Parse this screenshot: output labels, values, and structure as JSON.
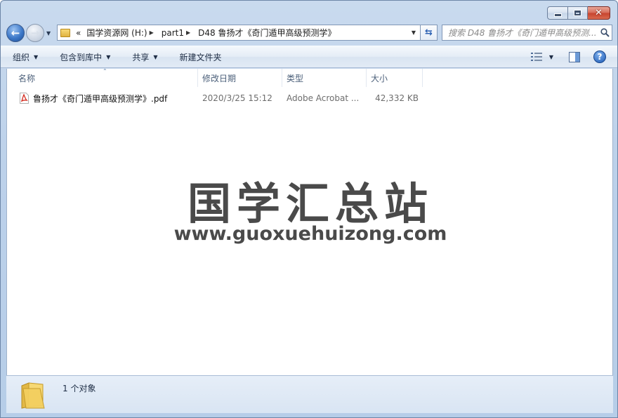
{
  "window": {
    "caption_buttons": [
      "minimize",
      "maximize",
      "close"
    ]
  },
  "address": {
    "overflow": "«",
    "segments": [
      "国学资源网 (H:)",
      "part1",
      "D48 鲁扬才《奇门遁甲高级预测学》"
    ]
  },
  "search": {
    "placeholder": "搜索 D48 鲁扬才《奇门遁甲高级预测..."
  },
  "toolbar": {
    "organize": "组织",
    "include_library": "包含到库中",
    "share": "共享",
    "new_folder": "新建文件夹"
  },
  "columns": {
    "name": "名称",
    "date": "修改日期",
    "type": "类型",
    "size": "大小"
  },
  "files": [
    {
      "name": "鲁扬才《奇门遁甲高级预测学》.pdf",
      "date": "2020/3/25 15:12",
      "type": "Adobe Acrobat ...",
      "size": "42,332 KB",
      "icon": "pdf-icon"
    }
  ],
  "watermark": {
    "chinese": "国学汇总站",
    "url": "www.guoxuehuizong.com"
  },
  "status": {
    "count": "1 个对象"
  },
  "colors": {
    "frame": "#bcd1ea",
    "accent": "#3d78c8",
    "pdf_red": "#d42a1e"
  }
}
